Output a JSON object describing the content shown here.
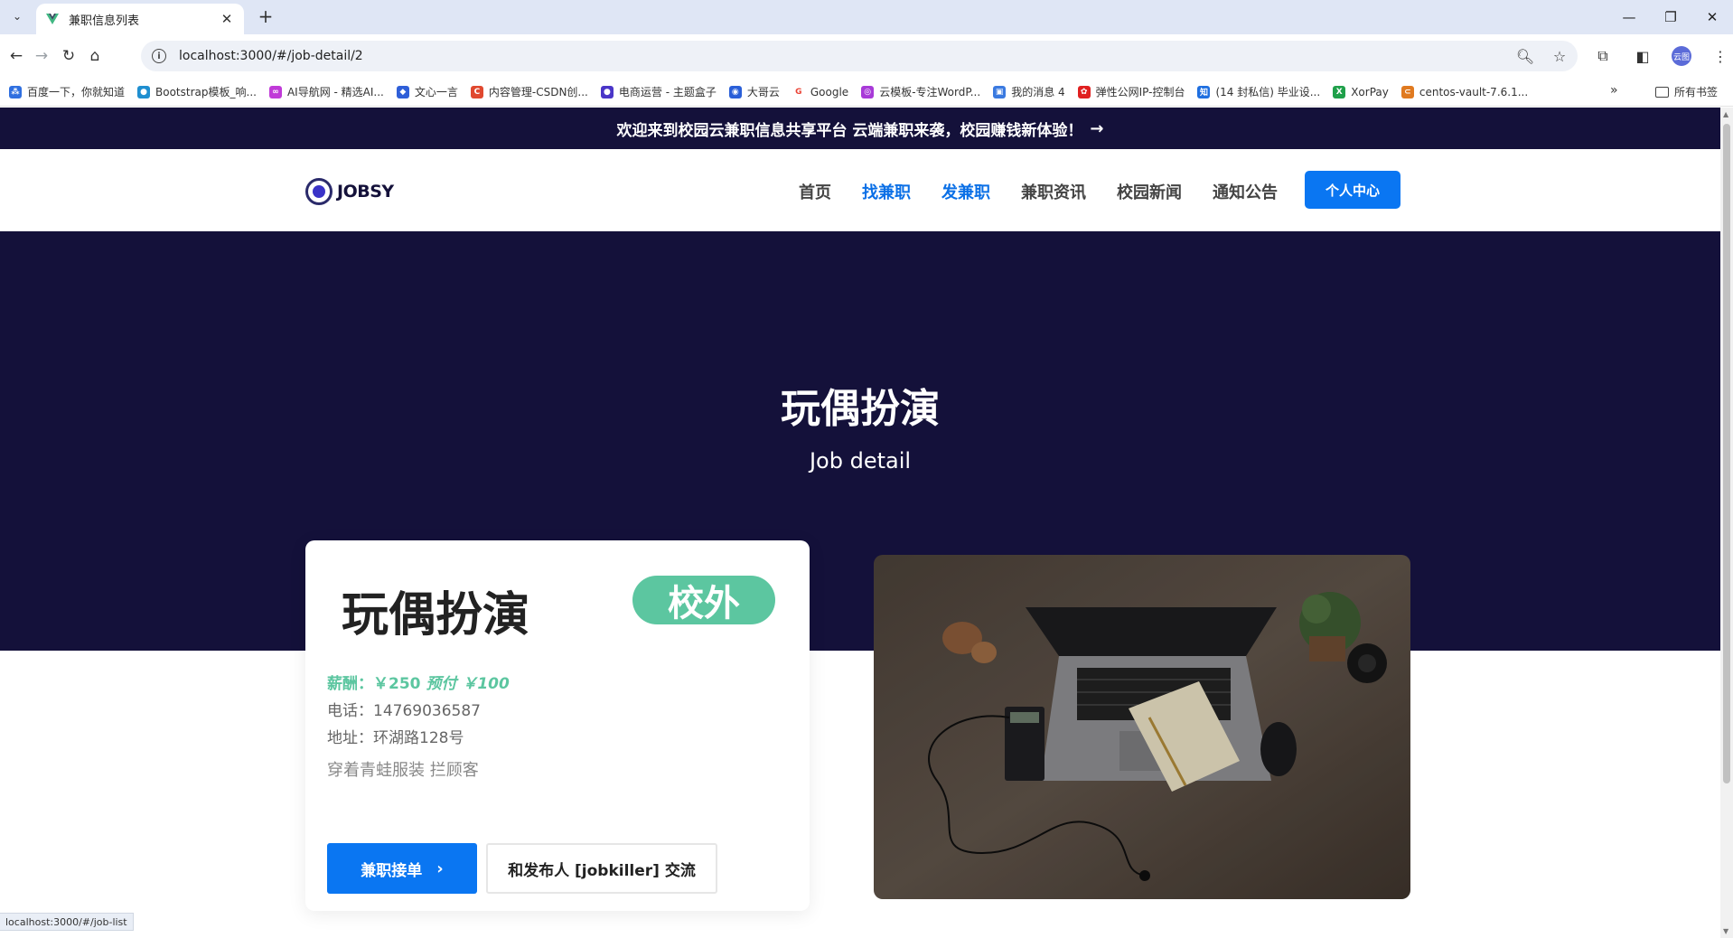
{
  "browser": {
    "tab_title": "兼职信息列表",
    "url": "localhost:3000/#/job-detail/2",
    "status_url": "localhost:3000/#/job-list",
    "bookmarks": [
      {
        "label": "百度一下，你就知道",
        "color": "#2f6fe0"
      },
      {
        "label": "Bootstrap模板_响...",
        "color": "#1f8fd0"
      },
      {
        "label": "AI导航网 - 精选AI...",
        "color": "#c03ad8"
      },
      {
        "label": "文心一言",
        "color": "#2f5fd8"
      },
      {
        "label": "内容管理-CSDN创...",
        "color": "#e0482f"
      },
      {
        "label": "电商运营 - 主题盒子",
        "color": "#4a36c8"
      },
      {
        "label": "大哥云",
        "color": "#2a5fd8"
      },
      {
        "label": "Google",
        "color": "#ea4335"
      },
      {
        "label": "云模板-专注WordP...",
        "color": "#a83ad8"
      },
      {
        "label": "我的消息 4",
        "color": "#3a7ae0"
      },
      {
        "label": "弹性公网IP-控制台",
        "color": "#e02020"
      },
      {
        "label": "(14 封私信) 毕业设...",
        "color": "#1f6fe0"
      },
      {
        "label": "XorPay",
        "color": "#1fa04a"
      },
      {
        "label": "centos-vault-7.6.1...",
        "color": "#e07a20"
      }
    ],
    "all_bookmarks_label": "所有书签",
    "profile_label": "云图"
  },
  "site": {
    "announcement": "欢迎来到校园云兼职信息共享平台 云端兼职来袭，校园赚钱新体验！",
    "announcement_arrow": "→",
    "logo_text": "JOBSY",
    "nav": [
      {
        "label": "首页",
        "active": false
      },
      {
        "label": "找兼职",
        "active": true
      },
      {
        "label": "发兼职",
        "active": true
      },
      {
        "label": "兼职资讯",
        "active": false
      },
      {
        "label": "校园新闻",
        "active": false
      },
      {
        "label": "通知公告",
        "active": false
      }
    ],
    "user_center_label": "个人中心",
    "accent_color": "#0a76f2",
    "hero_bg_color": "#14113a"
  },
  "hero": {
    "title": "玩偶扮演",
    "subtitle": "Job detail"
  },
  "job": {
    "title": "玩偶扮演",
    "badge": "校外",
    "pay_label": "薪酬：",
    "pay_amount": "￥250",
    "prepay": "预付 ￥100",
    "phone": "电话：14769036587",
    "address": "地址：环湖路128号",
    "description": "穿着青蛙服装 拦顾客",
    "accept_label": "兼职接单",
    "chat_label": "和发布人 [jobkiller] 交流",
    "badge_color": "#5cc6a0"
  }
}
